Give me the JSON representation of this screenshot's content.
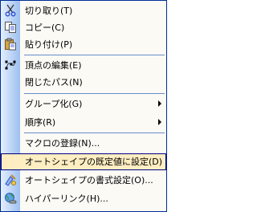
{
  "menu": {
    "items": [
      {
        "label": "切り取り(T)",
        "icon": "scissors-icon"
      },
      {
        "label": "コピー(C)",
        "icon": "copy-icon"
      },
      {
        "label": "貼り付け(P)",
        "icon": "paste-icon"
      },
      {
        "label": "頂点の編集(E)",
        "icon": "edit-points-icon"
      },
      {
        "label": "閉じたパス(N)"
      },
      {
        "label": "グループ化(G)",
        "submenu": true
      },
      {
        "label": "順序(R)",
        "submenu": true
      },
      {
        "label": "マクロの登録(N)..."
      },
      {
        "label": "オートシェイプの既定値に設定(D)",
        "highlighted": true
      },
      {
        "label": "オートシェイプの書式設定(O)...",
        "icon": "format-autoshape-icon"
      },
      {
        "label": "ハイパーリンク(H)...",
        "icon": "hyperlink-icon"
      }
    ]
  },
  "colors": {
    "border": "#002d96",
    "highlight_bg": "#ffeec2",
    "highlight_border": "#000080",
    "gutter_start": "#e3effe",
    "gutter_end": "#9ebfef"
  }
}
